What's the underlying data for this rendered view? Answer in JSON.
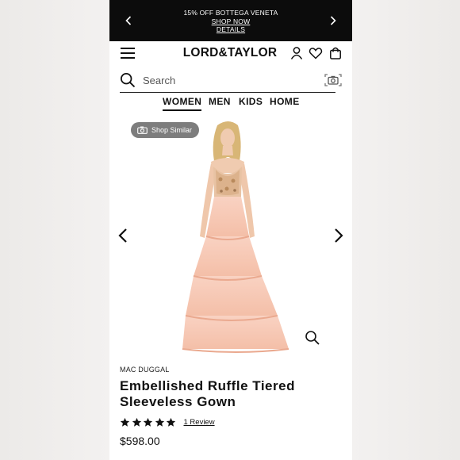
{
  "promo": {
    "headline": "15% OFF BOTTEGA VENETA",
    "shop_now": "SHOP NOW",
    "details": "DETAILS"
  },
  "header": {
    "logo": "LORD&TAYLOR",
    "icons": [
      "menu-icon",
      "account-icon",
      "heart-icon",
      "bag-icon"
    ]
  },
  "search": {
    "placeholder": "Search",
    "icons": [
      "search-icon",
      "camera-icon"
    ]
  },
  "nav": {
    "tabs": [
      {
        "label": "WOMEN",
        "active": true
      },
      {
        "label": "MEN",
        "active": false
      },
      {
        "label": "KIDS",
        "active": false
      },
      {
        "label": "HOME",
        "active": false
      }
    ]
  },
  "gallery": {
    "shop_similar": "Shop Similar"
  },
  "product": {
    "brand": "MAC DUGGAL",
    "title": "Embellished Ruffle Tiered Sleeveless Gown",
    "rating_stars": 5,
    "reviews": "1 Review",
    "price": "$598.00"
  },
  "colors": {
    "promo_bg": "#0c0c0c",
    "gown": "#f6c7b5",
    "badge": "#7d7d7d"
  }
}
